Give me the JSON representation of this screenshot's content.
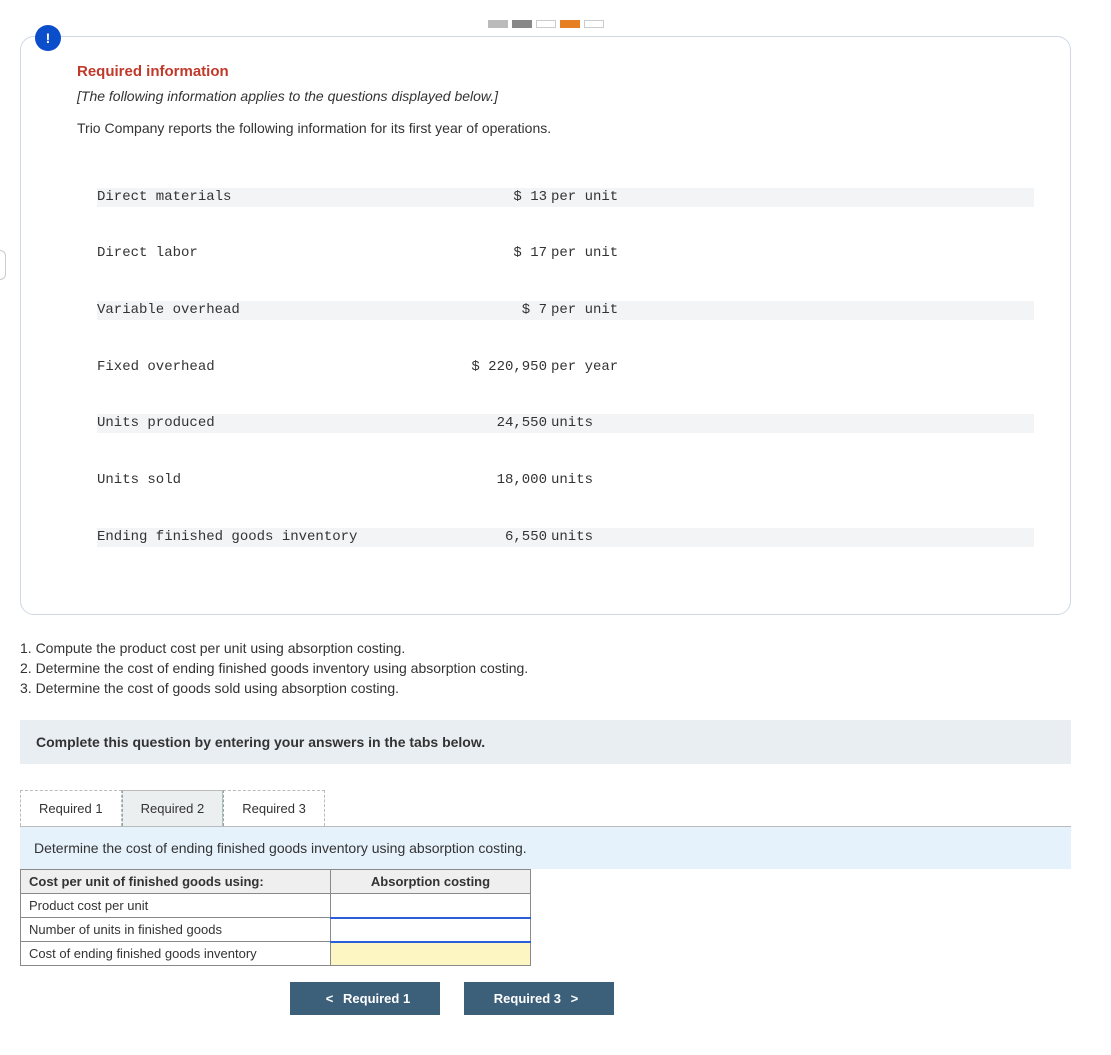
{
  "badge_icon": "!",
  "required_header": "Required information",
  "instruction_note": "[The following information applies to the questions displayed below.]",
  "company_line": "Trio Company reports the following information for its first year of operations.",
  "ledger": [
    {
      "label": "Direct materials",
      "value": "$ 13",
      "unit": "per unit"
    },
    {
      "label": "Direct labor",
      "value": "$ 17",
      "unit": "per unit"
    },
    {
      "label": "Variable overhead",
      "value": "$ 7",
      "unit": "per unit"
    },
    {
      "label": "Fixed overhead",
      "value": "$ 220,950",
      "unit": "per year"
    },
    {
      "label": "Units produced",
      "value": "24,550",
      "unit": "units"
    },
    {
      "label": "Units sold",
      "value": "18,000",
      "unit": "units"
    },
    {
      "label": "Ending finished goods inventory",
      "value": "6,550",
      "unit": "units"
    }
  ],
  "questions": {
    "q1": "1. Compute the product cost per unit using absorption costing.",
    "q2": "2. Determine the cost of ending finished goods inventory using absorption costing.",
    "q3": "3. Determine the cost of goods sold using absorption costing."
  },
  "banner": "Complete this question by entering your answers in the tabs below.",
  "tabs": {
    "t1": "Required 1",
    "t2": "Required 2",
    "t3": "Required 3",
    "active": 2
  },
  "tab_prompt": "Determine the cost of ending finished goods inventory using absorption costing.",
  "table": {
    "h1": "Cost per unit of finished goods using:",
    "h2": "Absorption costing",
    "r1": "Product cost per unit",
    "r2": "Number of units in finished goods",
    "r3": "Cost of ending finished goods inventory"
  },
  "nav": {
    "prev": "Required 1",
    "next": "Required 3"
  }
}
